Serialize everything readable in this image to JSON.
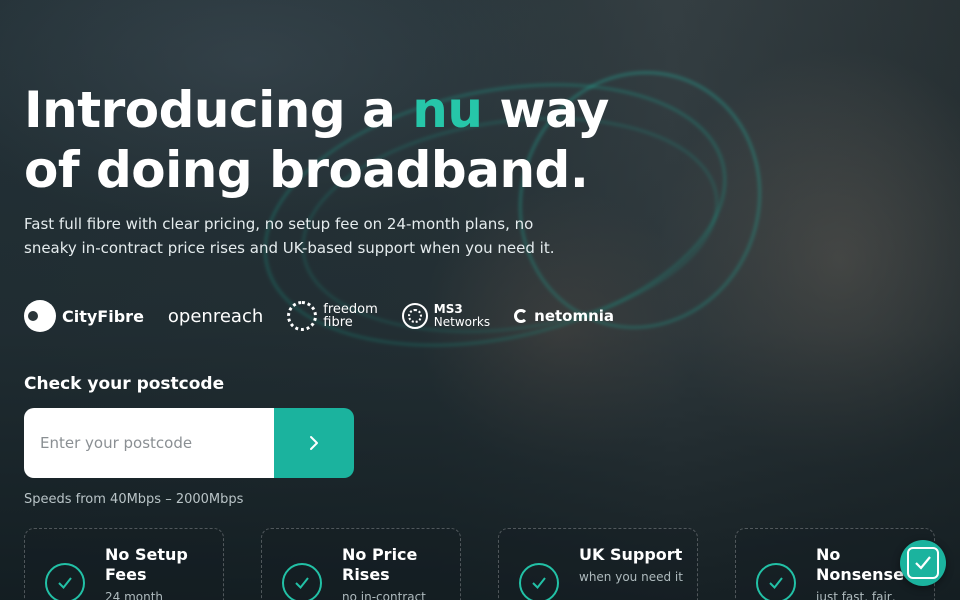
{
  "hero": {
    "title_line1_prefix": "Introducing a ",
    "title_accent": "nu",
    "title_line1_suffix": " way",
    "title_line2": "of doing broadband.",
    "subtitle": "Fast full fibre with clear pricing, no setup fee on 24-month plans, no sneaky in-contract price rises and UK-based support when you need it."
  },
  "partners": [
    {
      "name": "CityFibre",
      "icon": "cityfibre-logo"
    },
    {
      "name": "openreach",
      "icon": "openreach-logo"
    },
    {
      "name_line1": "freedom",
      "name_line2": "fibre",
      "icon": "freedom-fibre-logo"
    },
    {
      "name_line1": "MS3",
      "name_line2": "Networks",
      "icon": "ms3-networks-logo"
    },
    {
      "name": "netomnia",
      "icon": "netomnia-logo"
    }
  ],
  "postcode": {
    "heading": "Check your postcode",
    "placeholder": "Enter your postcode",
    "submit_icon": "chevron-right-icon",
    "speeds": "Speeds from 40Mbps – 2000Mbps"
  },
  "features": [
    {
      "title": "No Setup Fees",
      "desc": "24 month",
      "icon": "check-circle-icon"
    },
    {
      "title": "No Price Rises",
      "desc": "no in-contract",
      "icon": "check-circle-icon"
    },
    {
      "title": "UK Support",
      "desc": "when you need it",
      "icon": "check-circle-icon"
    },
    {
      "title": "No Nonsense",
      "desc": "just fast, fair,",
      "icon": "check-circle-icon"
    }
  ],
  "floating_badge": {
    "icon": "accessibility-check-icon"
  },
  "colors": {
    "accent": "#26c6a9",
    "button": "#1bb39e",
    "background": "#1d2a2e"
  }
}
